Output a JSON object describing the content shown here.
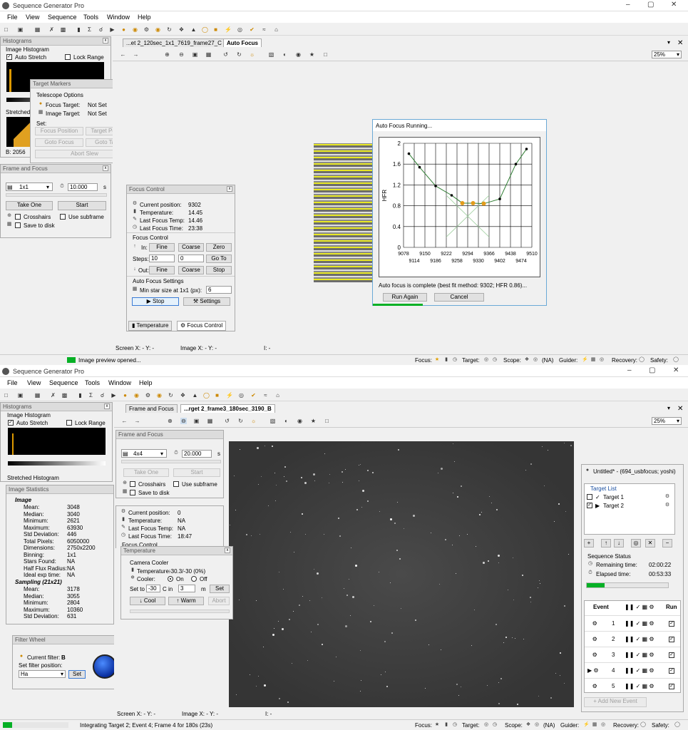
{
  "win1": {
    "title": "Sequence Generator Pro",
    "menu": [
      "File",
      "View",
      "Sequence",
      "Tools",
      "Window",
      "Help"
    ],
    "hist_panel_title": "Histograms",
    "hist_label": "Image Histogram",
    "auto_stretch": "Auto Stretch",
    "lock_range": "Lock Range",
    "stretched_label": "Stretched",
    "b_value": "B: 2056",
    "tabs": [
      "...et 2_120sec_1x1_7619_frame27_C",
      "Auto Focus"
    ],
    "zoom": "25%",
    "target_markers": {
      "title": "Target Markers",
      "section": "Telescope Options",
      "focus_target_label": "Focus Target:",
      "focus_target_value": "Not Set",
      "image_target_label": "Image Target:",
      "image_target_value": "Not Set",
      "set_label": "Set:",
      "btn_focus_position": "Focus Position",
      "btn_target_position": "Target Position",
      "btn_goto_focus": "Goto Focus",
      "btn_goto_target": "Goto Target",
      "btn_abort_slew": "Abort Slew"
    },
    "frame_focus": {
      "title": "Frame and Focus",
      "binning": "1x1",
      "exposure": "10.000",
      "unit": "s",
      "take_one": "Take One",
      "start": "Start",
      "crosshairs": "Crosshairs",
      "use_subframe": "Use subframe",
      "save_to_disk": "Save to disk"
    },
    "focus_control": {
      "title": "Focus Control",
      "current_position_label": "Current position:",
      "current_position": "9302",
      "temperature_label": "Temperature:",
      "temperature": "14.45",
      "last_focus_temp_label": "Last Focus Temp:",
      "last_focus_temp": "14.46",
      "last_focus_time_label": "Last Focus Time:",
      "last_focus_time": "23:38",
      "section_focus": "Focus Control",
      "in_label": "In:",
      "fine": "Fine",
      "coarse": "Coarse",
      "zero": "Zero",
      "steps_label": "Steps:",
      "steps_value": "10",
      "goto_value": "0",
      "goto": "Go To",
      "out_label": "Out:",
      "stop": "Stop",
      "section_af": "Auto Focus Settings",
      "min_star_label": "Min star size at 1x1 (px):",
      "min_star_value": "6",
      "stop_btn": "Stop",
      "settings_btn": "Settings",
      "tab_temperature": "Temperature",
      "tab_focus_control": "Focus Control"
    },
    "autofocus": {
      "title": "Auto Focus Running...",
      "ylabel": "HFR",
      "message": "Auto focus is complete (best fit method: 9302; HFR 0.86)...",
      "run_again": "Run Again",
      "cancel": "Cancel"
    },
    "coords": {
      "screen": "Screen X: - Y: -",
      "image": "Image X: - Y: -",
      "i": "I: -"
    },
    "status_text": "Image preview opened...",
    "status_right": {
      "focus": "Focus:",
      "target": "Target:",
      "scope": "Scope:",
      "scope_na": "(NA)",
      "guider": "Guider:",
      "recovery": "Recovery:",
      "safety": "Safety:"
    }
  },
  "chart_data": {
    "type": "scatter",
    "title": "",
    "xlabel": "",
    "ylabel": "HFR",
    "xlim": [
      9078,
      9510
    ],
    "ylim": [
      0,
      2
    ],
    "x_ticks_row1": [
      "9078",
      "9150",
      "9222",
      "9294",
      "9366",
      "9438",
      "9510"
    ],
    "x_ticks_row2": [
      "9114",
      "9186",
      "9258",
      "9330",
      "9402",
      "9474"
    ],
    "y_ticks": [
      "0",
      "0.4",
      "0.8",
      "1.2",
      "1.6",
      "2"
    ],
    "grid": true,
    "series": [
      {
        "x": [
          9096,
          9132,
          9186,
          9240,
          9276,
          9312,
          9348,
          9402,
          9456,
          9492
        ],
        "y": [
          1.8,
          1.54,
          1.18,
          1.0,
          0.85,
          0.85,
          0.84,
          0.93,
          1.6,
          1.89
        ]
      }
    ],
    "fit_points": {
      "x": [
        9276,
        9312,
        9348
      ],
      "y": [
        0.85,
        0.85,
        0.84
      ]
    }
  },
  "win2": {
    "title": "Sequence Generator Pro",
    "menu": [
      "File",
      "View",
      "Sequence",
      "Tools",
      "Window",
      "Help"
    ],
    "hist_panel_title": "Histograms",
    "hist_label": "Image Histogram",
    "auto_stretch": "Auto Stretch",
    "lock_range": "Lock Range",
    "stretched_label": "Stretched Histogram",
    "tabs": [
      "Frame and Focus",
      "...rget 2_frame3_180sec_3190_B"
    ],
    "zoom": "25%",
    "stats": {
      "title": "Image Statistics",
      "image_header": "Image",
      "rows": [
        {
          "k": "Mean:",
          "v": "3048"
        },
        {
          "k": "Median:",
          "v": "3040"
        },
        {
          "k": "Minimum:",
          "v": "2621"
        },
        {
          "k": "Maximum:",
          "v": "63930"
        },
        {
          "k": "Std Deviation:",
          "v": "446"
        },
        {
          "k": "Total Pixels:",
          "v": "6050000"
        },
        {
          "k": "Dimensions:",
          "v": "2750x2200"
        },
        {
          "k": "Binning:",
          "v": "1x1"
        },
        {
          "k": "Stars Found:",
          "v": "NA"
        },
        {
          "k": "Half Flux Radius:",
          "v": "NA"
        },
        {
          "k": "Ideal exp time:",
          "v": "NA"
        }
      ],
      "sampling_header": "Sampling (21x21)",
      "sampling_rows": [
        {
          "k": "Mean:",
          "v": "3178"
        },
        {
          "k": "Median:",
          "v": "3055"
        },
        {
          "k": "Minimum:",
          "v": "2804"
        },
        {
          "k": "Maximum:",
          "v": "10360"
        },
        {
          "k": "Std Deviation:",
          "v": "631"
        }
      ]
    },
    "filter": {
      "title": "Filter Wheel",
      "current_label": "Current filter:",
      "current_value": "B",
      "set_label": "Set filter position:",
      "select_value": "Ha",
      "set_btn": "Set"
    },
    "frame_focus": {
      "title": "Frame and Focus",
      "binning": "4x4",
      "exposure": "20.000",
      "unit": "s",
      "take_one": "Take One",
      "start": "Start",
      "crosshairs": "Crosshairs",
      "use_subframe": "Use subframe",
      "save_to_disk": "Save to disk"
    },
    "focus_partial": {
      "current_position_label": "Current position:",
      "current_position": "0",
      "temperature_label": "Temperature:",
      "temperature": "NA",
      "last_focus_temp_label": "Last Focus Temp:",
      "last_focus_temp": "NA",
      "last_focus_time_label": "Last Focus Time:",
      "last_focus_time": "18:47",
      "section_focus": "Focus Control"
    },
    "temperature": {
      "title": "Temperature",
      "section": "Camera Cooler",
      "temp_label": "Temperature:",
      "temp_value": "-30.3/-30 (0%)",
      "cooler_label": "Cooler:",
      "on": "On",
      "off": "Off",
      "set_to": "Set to",
      "set_value": "-30",
      "c_in": "C in",
      "minutes": "3",
      "m": "m",
      "set_btn": "Set",
      "cool": "Cool",
      "warm": "Warm",
      "abort": "Abort"
    },
    "sequence": {
      "title": "Untitled* - (694_usbfocus; yoshi)",
      "target_list_label": "Target List",
      "targets": [
        "Target 1",
        "Target 2"
      ],
      "status_label": "Sequence Status",
      "remaining_label": "Remaining time:",
      "remaining": "02:00:22",
      "elapsed_label": "Elapsed time:",
      "elapsed": "00:53:33",
      "progress": 0.22,
      "event_header": "Event",
      "run_header": "Run",
      "events": [
        "1",
        "2",
        "3",
        "4",
        "5"
      ],
      "add_event": "Add New Event"
    },
    "coords": {
      "screen": "Screen X: - Y: -",
      "image": "Image X: - Y: -",
      "i": "I: -"
    },
    "status_text": "Integrating Target 2; Event 4; Frame 4 for 180s (23s)",
    "status_progress": 0.14,
    "status_right": {
      "focus": "Focus:",
      "target": "Target:",
      "scope": "Scope:",
      "scope_na": "(NA)",
      "guider": "Guider:",
      "recovery": "Recovery:",
      "safety": "Safety:"
    }
  }
}
